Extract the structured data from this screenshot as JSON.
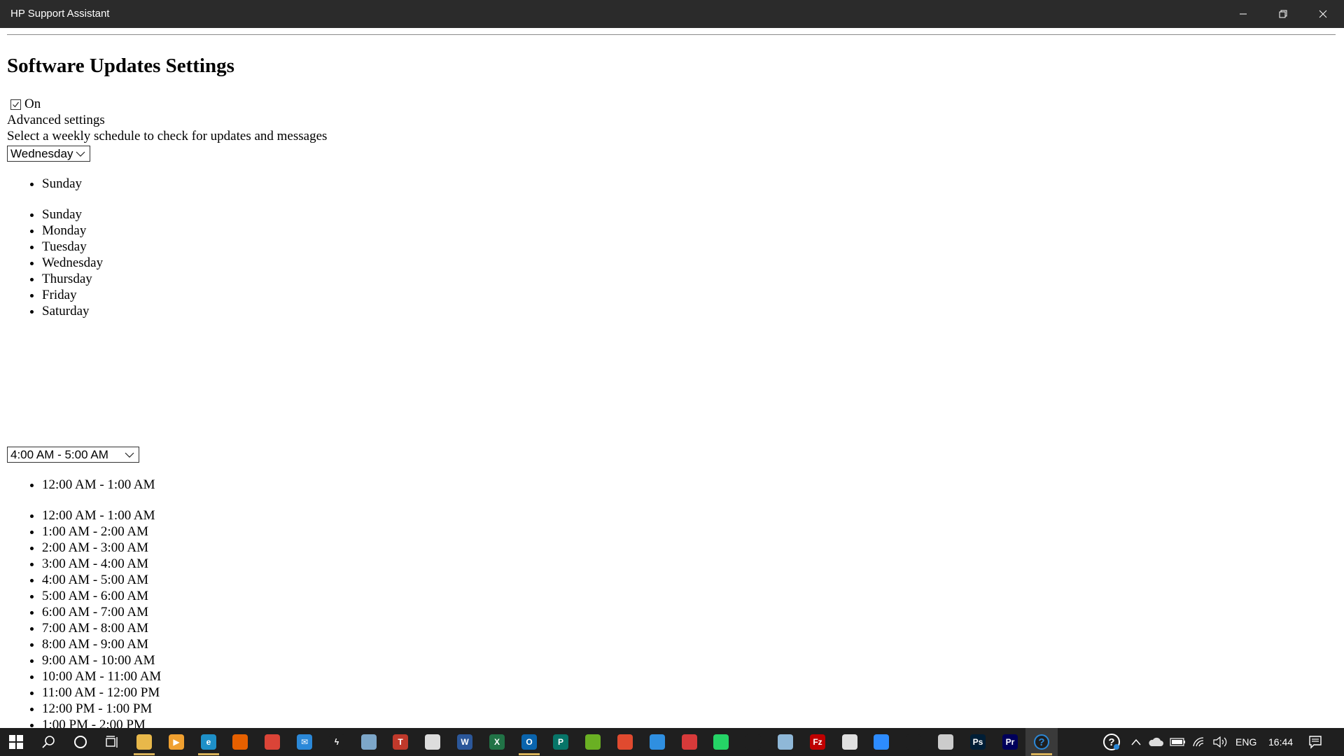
{
  "window": {
    "title": "HP Support Assistant"
  },
  "page": {
    "heading": "Software Updates Settings",
    "toggle_label": "On",
    "toggle_checked": true,
    "advanced_label": "Advanced settings",
    "schedule_label": "Select a weekly schedule to check for updates and messages"
  },
  "day_picker": {
    "selected_value": "Wednesday",
    "selected_list_item": "Sunday",
    "options": [
      "Sunday",
      "Monday",
      "Tuesday",
      "Wednesday",
      "Thursday",
      "Friday",
      "Saturday"
    ]
  },
  "time_picker": {
    "selected_value": "4:00 AM - 5:00 AM",
    "selected_list_item": "12:00 AM - 1:00 AM",
    "options": [
      "12:00 AM - 1:00 AM",
      "1:00 AM - 2:00 AM",
      "2:00 AM - 3:00 AM",
      "3:00 AM - 4:00 AM",
      "4:00 AM - 5:00 AM",
      "5:00 AM - 6:00 AM",
      "6:00 AM - 7:00 AM",
      "7:00 AM - 8:00 AM",
      "8:00 AM - 9:00 AM",
      "9:00 AM - 10:00 AM",
      "10:00 AM - 11:00 AM",
      "11:00 AM - 12:00 PM",
      "12:00 PM - 1:00 PM",
      "1:00 PM - 2:00 PM"
    ]
  },
  "taskbar": {
    "apps": [
      {
        "name": "file-explorer-icon",
        "color": "#e8b84a",
        "glyph": "",
        "active": true
      },
      {
        "name": "media-player-icon",
        "color": "#f0a030",
        "glyph": "▶",
        "active": false
      },
      {
        "name": "edge-browser-icon",
        "color": "#1e90c8",
        "glyph": "e",
        "active": true
      },
      {
        "name": "firefox-icon",
        "color": "#e66000",
        "glyph": "",
        "active": false
      },
      {
        "name": "chrome-icon",
        "color": "#db4437",
        "glyph": "",
        "active": false
      },
      {
        "name": "mail-icon",
        "color": "#2b88d8",
        "glyph": "✉",
        "active": false
      },
      {
        "name": "power-automate-icon",
        "color": "#1f1f1f",
        "glyph": "ϟ",
        "active": false
      },
      {
        "name": "documents-icon",
        "color": "#7da7c9",
        "glyph": "",
        "active": false
      },
      {
        "name": "tally-icon",
        "color": "#c0392b",
        "glyph": "T",
        "active": false
      },
      {
        "name": "store-icon",
        "color": "#dddddd",
        "glyph": "",
        "active": false
      },
      {
        "name": "word-icon",
        "color": "#2b579a",
        "glyph": "W",
        "active": false
      },
      {
        "name": "excel-icon",
        "color": "#217346",
        "glyph": "X",
        "active": false
      },
      {
        "name": "outlook-icon",
        "color": "#0a64ad",
        "glyph": "O",
        "active": true
      },
      {
        "name": "publisher-icon",
        "color": "#077568",
        "glyph": "P",
        "active": false
      },
      {
        "name": "green-app-icon",
        "color": "#6ab023",
        "glyph": "",
        "active": false
      },
      {
        "name": "red-app-icon",
        "color": "#e04a2f",
        "glyph": "",
        "active": false
      },
      {
        "name": "blue-document-icon",
        "color": "#2f8fe0",
        "glyph": "",
        "active": false
      },
      {
        "name": "anydesk-icon",
        "color": "#d73a3a",
        "glyph": "",
        "active": false
      },
      {
        "name": "whatsapp-icon",
        "color": "#25d366",
        "glyph": "",
        "active": false
      },
      {
        "name": "cortana-icon",
        "color": "#1f1f1f",
        "glyph": "",
        "active": false
      },
      {
        "name": "notes-icon",
        "color": "#8fb8d8",
        "glyph": "",
        "active": false
      },
      {
        "name": "filezilla-icon",
        "color": "#bf0000",
        "glyph": "Fz",
        "active": false
      },
      {
        "name": "paint-icon",
        "color": "#e0e0e0",
        "glyph": "",
        "active": false
      },
      {
        "name": "zoom-icon",
        "color": "#2d8cff",
        "glyph": "",
        "active": false
      },
      {
        "name": "vscode-icon",
        "color": "#1f1f1f",
        "glyph": "",
        "active": false
      },
      {
        "name": "sticky-notes-icon",
        "color": "#cccccc",
        "glyph": "",
        "active": false
      },
      {
        "name": "photoshop-icon",
        "color": "#001e36",
        "glyph": "Ps",
        "active": false
      },
      {
        "name": "premiere-icon",
        "color": "#00005b",
        "glyph": "Pr",
        "active": false
      },
      {
        "name": "hp-support-icon",
        "color": "#1f1f1f",
        "glyph": "?",
        "active": true
      }
    ],
    "language": "ENG",
    "clock": "16:44"
  }
}
